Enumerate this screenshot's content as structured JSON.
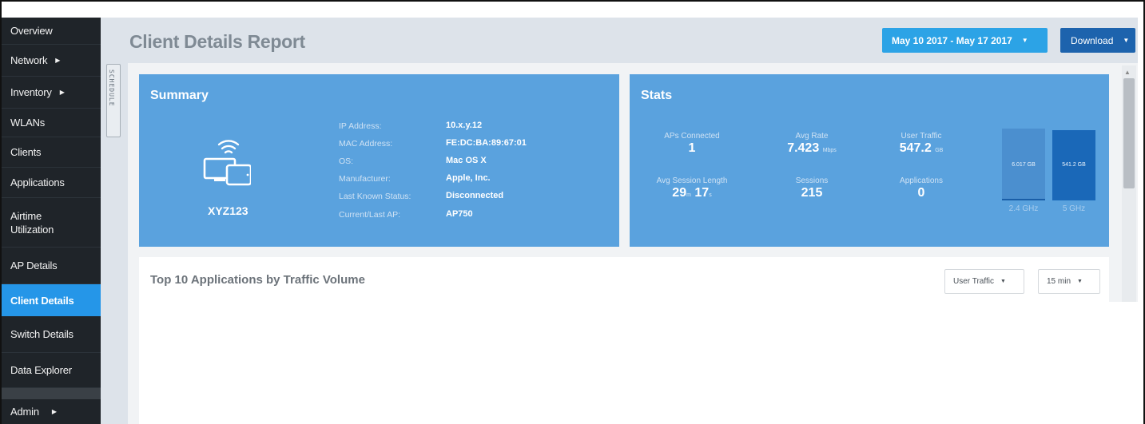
{
  "sidebar": {
    "items": [
      {
        "label": "Overview",
        "arrow": false
      },
      {
        "label": "Network",
        "arrow": true
      },
      {
        "label": "Inventory",
        "arrow": true
      },
      {
        "label": "WLANs",
        "arrow": false
      },
      {
        "label": "Clients",
        "arrow": false
      },
      {
        "label": "Applications",
        "arrow": false
      },
      {
        "label": "Airtime\nUtilization",
        "arrow": false
      },
      {
        "label": "AP Details",
        "arrow": false
      },
      {
        "label": "Client Details",
        "arrow": false,
        "active": true
      },
      {
        "label": "Switch Details",
        "arrow": false
      },
      {
        "label": "Data Explorer",
        "arrow": false
      },
      {
        "label": "Admin",
        "arrow": true
      }
    ],
    "arrow_glyph": "▶"
  },
  "schedule_tab": "SCHEDULE",
  "header": {
    "title": "Client Details Report",
    "date_range": "May 10 2017 - May 17 2017",
    "download": "Download",
    "caret": "▼"
  },
  "summary": {
    "title": "Summary",
    "icon": "wifi-devices-icon",
    "client_name": "XYZ123",
    "fields": [
      {
        "label": "IP Address:",
        "value": "10.x.y.12"
      },
      {
        "label": "MAC Address:",
        "value": "FE:DC:BA:89:67:01"
      },
      {
        "label": "OS:",
        "value": "Mac OS X"
      },
      {
        "label": "Manufacturer:",
        "value": "Apple, Inc."
      },
      {
        "label": "Last Known Status:",
        "value": "Disconnected"
      },
      {
        "label": "Current/Last AP:",
        "value": "AP750"
      }
    ]
  },
  "stats": {
    "title": "Stats",
    "aps_connected": {
      "label": "APs Connected",
      "value": "1"
    },
    "avg_rate": {
      "label": "Avg Rate",
      "value": "7.423",
      "unit": "Mbps"
    },
    "user_traffic": {
      "label": "User Traffic",
      "value": "547.2",
      "unit": "GB"
    },
    "avg_session": {
      "label": "Avg Session Length",
      "m": "29",
      "m_unit": "m",
      "s": "17",
      "s_unit": "s"
    },
    "sessions": {
      "label": "Sessions",
      "value": "215"
    },
    "applications": {
      "label": "Applications",
      "value": "0"
    },
    "bands": [
      {
        "label": "2.4 GHz",
        "value": "6.017 GB"
      },
      {
        "label": "5 GHz",
        "value": "541.2 GB"
      }
    ]
  },
  "apps_panel": {
    "title": "Top 10 Applications by Traffic Volume",
    "metric_select": "User Traffic",
    "interval_select": "15 min"
  },
  "colors": {
    "sidebar_bg": "#1f2429",
    "active": "#2596e8",
    "panel": "#5aa2de",
    "date_button": "#2ca3e6",
    "download_button": "#1d63ad"
  }
}
